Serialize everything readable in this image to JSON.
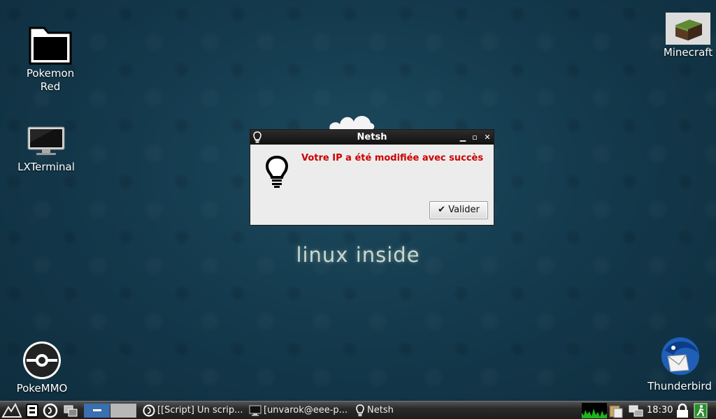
{
  "desktop": {
    "icons": [
      {
        "label_line1": "Pokemon",
        "label_line2": "Red",
        "icon": "folder-icon"
      },
      {
        "label": "LXTerminal",
        "icon": "monitor-icon"
      },
      {
        "label": "PokeMMO",
        "icon": "pokeball-icon"
      },
      {
        "label": "Minecraft",
        "icon": "minecraft-block-icon"
      },
      {
        "label": "Thunderbird",
        "icon": "thunderbird-icon"
      }
    ],
    "wallpaper_text": "linux inside"
  },
  "dialog": {
    "title": "Netsh",
    "message": "Votre IP a été modifiée avec succès",
    "ok_button": "Valider",
    "message_color": "#cc0000"
  },
  "taskbar": {
    "tasks": [
      {
        "label": "[[Script] Un scrip...",
        "icon": "script-icon"
      },
      {
        "label": "[unvarok@eee-p...",
        "icon": "terminal-icon"
      },
      {
        "label": "Netsh",
        "icon": "lightbulb-icon"
      }
    ],
    "clock": "18:30",
    "accent": "#3a6fb0"
  }
}
